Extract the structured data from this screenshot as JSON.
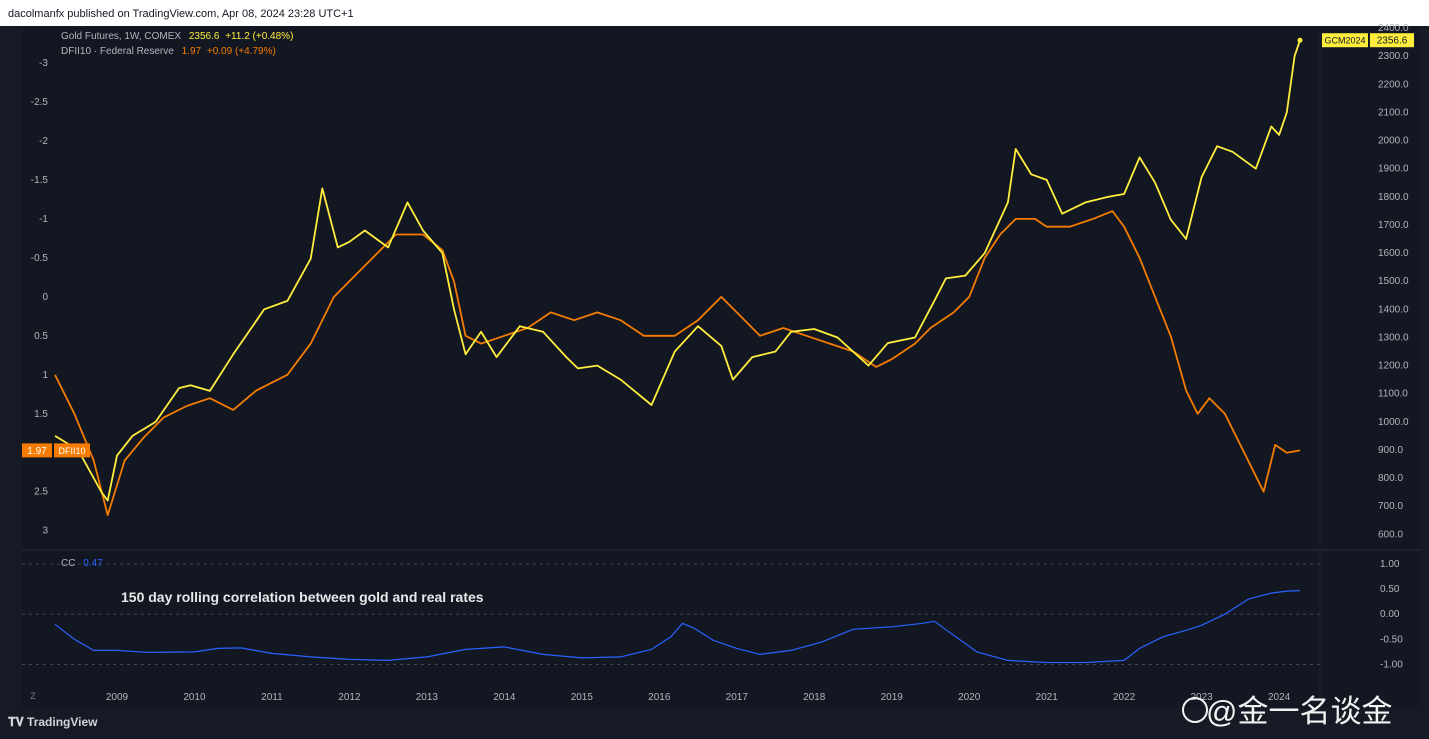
{
  "header": {
    "publisher_line": "dacolmanfx published on TradingView.com, Apr 08, 2024 23:28 UTC+1"
  },
  "legend": {
    "gold": {
      "label": "Gold Futures, 1W, COMEX",
      "value": "2356.6",
      "change": "+11.2 (+0.48%)"
    },
    "dfii": {
      "label": "DFII10 · Federal Reserve",
      "value": "1.97",
      "change": "+0.09 (+4.79%)"
    },
    "cc": {
      "label": "CC",
      "value": "0.47"
    }
  },
  "price_tags": {
    "gold": {
      "symbol": "GCM2024",
      "value": "2356.6"
    },
    "dfii": {
      "value": "1.97",
      "symbol": "DFII10"
    }
  },
  "annotation": "150 day rolling correlation between gold and real rates",
  "branding": {
    "tradingview": "TradingView",
    "watermark": "@金一名谈金"
  },
  "colors": {
    "gold": "#ffee3d",
    "dfii": "#f57c00",
    "cc": "#2962ff",
    "bg": "#131722",
    "tag_gold": "#ffee3d",
    "tag_dfii": "#f57c00"
  },
  "chart_data": [
    {
      "type": "line",
      "x_ticks": [
        "2009",
        "2010",
        "2011",
        "2012",
        "2013",
        "2014",
        "2015",
        "2016",
        "2017",
        "2018",
        "2019",
        "2020",
        "2021",
        "2022",
        "2023",
        "2024"
      ],
      "x_range": [
        2008.2,
        2024.27
      ],
      "right_axis": {
        "ticks": [
          "2400.0",
          "2300.0",
          "2200.0",
          "2100.0",
          "2000.0",
          "1900.0",
          "1800.0",
          "1700.0",
          "1600.0",
          "1500.0",
          "1400.0",
          "1300.0",
          "1200.0",
          "1100.0",
          "1000.0",
          "900.0",
          "800.0",
          "700.0",
          "600.0"
        ],
        "range": [
          580,
          2400
        ]
      },
      "left_axis": {
        "ticks": [
          "-3",
          "-2.5",
          "-2",
          "-1.5",
          "-1",
          "-0.5",
          "0",
          "0.5",
          "1",
          "1.5",
          "2",
          "2.5",
          "3"
        ],
        "range": [
          3.12,
          -3.45
        ],
        "inverted": true
      },
      "series": [
        {
          "name": "Gold Futures",
          "axis": "right",
          "x": [
            2008.2,
            2008.5,
            2008.8,
            2008.88,
            2009.0,
            2009.2,
            2009.5,
            2009.8,
            2009.95,
            2010.2,
            2010.5,
            2010.9,
            2011.2,
            2011.5,
            2011.65,
            2011.85,
            2012.0,
            2012.2,
            2012.5,
            2012.75,
            2012.95,
            2013.2,
            2013.35,
            2013.5,
            2013.7,
            2013.9,
            2014.2,
            2014.5,
            2014.8,
            2014.95,
            2015.2,
            2015.5,
            2015.9,
            2016.2,
            2016.5,
            2016.8,
            2016.95,
            2017.2,
            2017.5,
            2017.7,
            2018.0,
            2018.3,
            2018.7,
            2018.95,
            2019.3,
            2019.55,
            2019.7,
            2019.95,
            2020.2,
            2020.5,
            2020.6,
            2020.8,
            2021.0,
            2021.2,
            2021.5,
            2021.8,
            2022.0,
            2022.2,
            2022.4,
            2022.6,
            2022.8,
            2023.0,
            2023.2,
            2023.4,
            2023.7,
            2023.9,
            2024.0,
            2024.1,
            2024.2,
            2024.27
          ],
          "y": [
            950,
            900,
            750,
            720,
            880,
            950,
            1000,
            1120,
            1130,
            1110,
            1240,
            1400,
            1430,
            1580,
            1830,
            1620,
            1640,
            1680,
            1620,
            1780,
            1680,
            1600,
            1400,
            1240,
            1320,
            1230,
            1340,
            1320,
            1230,
            1190,
            1200,
            1150,
            1060,
            1250,
            1340,
            1270,
            1150,
            1230,
            1250,
            1320,
            1330,
            1300,
            1200,
            1280,
            1300,
            1430,
            1510,
            1520,
            1600,
            1780,
            1970,
            1880,
            1860,
            1740,
            1780,
            1800,
            1810,
            1940,
            1850,
            1720,
            1650,
            1870,
            1980,
            1960,
            1900,
            2050,
            2020,
            2100,
            2300,
            2356.6
          ]
        },
        {
          "name": "DFII10",
          "axis": "left",
          "x": [
            2008.2,
            2008.45,
            2008.7,
            2008.88,
            2009.1,
            2009.35,
            2009.6,
            2009.9,
            2010.2,
            2010.5,
            2010.8,
            2011.2,
            2011.5,
            2011.8,
            2012.0,
            2012.3,
            2012.6,
            2012.95,
            2013.2,
            2013.35,
            2013.5,
            2013.7,
            2014.0,
            2014.3,
            2014.6,
            2014.9,
            2015.2,
            2015.5,
            2015.8,
            2016.2,
            2016.5,
            2016.8,
            2017.0,
            2017.3,
            2017.6,
            2017.9,
            2018.2,
            2018.5,
            2018.8,
            2019.0,
            2019.3,
            2019.5,
            2019.8,
            2020.0,
            2020.2,
            2020.4,
            2020.6,
            2020.85,
            2021.0,
            2021.3,
            2021.6,
            2021.85,
            2022.0,
            2022.2,
            2022.4,
            2022.6,
            2022.8,
            2022.95,
            2023.1,
            2023.3,
            2023.45,
            2023.6,
            2023.8,
            2023.95,
            2024.1,
            2024.27
          ],
          "y": [
            1.0,
            1.5,
            2.1,
            2.8,
            2.1,
            1.8,
            1.55,
            1.4,
            1.3,
            1.45,
            1.2,
            1.0,
            0.6,
            0.0,
            -0.2,
            -0.5,
            -0.8,
            -0.8,
            -0.6,
            -0.2,
            0.5,
            0.6,
            0.5,
            0.4,
            0.2,
            0.3,
            0.2,
            0.3,
            0.5,
            0.5,
            0.3,
            0.0,
            0.2,
            0.5,
            0.4,
            0.5,
            0.6,
            0.7,
            0.9,
            0.8,
            0.6,
            0.4,
            0.2,
            0.0,
            -0.5,
            -0.8,
            -1.0,
            -1.0,
            -0.9,
            -0.9,
            -1.0,
            -1.1,
            -0.9,
            -0.5,
            0.0,
            0.5,
            1.2,
            1.5,
            1.3,
            1.5,
            1.8,
            2.1,
            2.5,
            1.9,
            2.0,
            1.97
          ]
        }
      ]
    },
    {
      "type": "line",
      "title": "150 day rolling correlation between gold and real rates",
      "y_ticks": [
        "1.00",
        "0.50",
        "0.00",
        "-0.50",
        "-1.00"
      ],
      "y_range": [
        -1.15,
        1.0
      ],
      "series": [
        {
          "name": "CC",
          "x": [
            2008.2,
            2008.45,
            2008.7,
            2009.0,
            2009.4,
            2010.0,
            2010.3,
            2010.6,
            2011.0,
            2011.5,
            2012.0,
            2012.5,
            2013.0,
            2013.5,
            2014.0,
            2014.5,
            2015.0,
            2015.5,
            2015.9,
            2016.15,
            2016.3,
            2016.45,
            2016.7,
            2017.0,
            2017.3,
            2017.7,
            2018.1,
            2018.5,
            2019.0,
            2019.4,
            2019.55,
            2019.8,
            2020.1,
            2020.5,
            2021.0,
            2021.5,
            2022.0,
            2022.2,
            2022.5,
            2022.8,
            2023.0,
            2023.3,
            2023.6,
            2023.9,
            2024.1,
            2024.27
          ],
          "y": [
            -0.2,
            -0.5,
            -0.72,
            -0.72,
            -0.76,
            -0.75,
            -0.68,
            -0.67,
            -0.78,
            -0.85,
            -0.9,
            -0.92,
            -0.85,
            -0.7,
            -0.65,
            -0.8,
            -0.87,
            -0.85,
            -0.7,
            -0.45,
            -0.18,
            -0.28,
            -0.52,
            -0.68,
            -0.8,
            -0.72,
            -0.55,
            -0.3,
            -0.25,
            -0.18,
            -0.14,
            -0.42,
            -0.75,
            -0.92,
            -0.96,
            -0.96,
            -0.92,
            -0.68,
            -0.45,
            -0.32,
            -0.22,
            0.0,
            0.3,
            0.42,
            0.46,
            0.47
          ]
        }
      ]
    }
  ]
}
